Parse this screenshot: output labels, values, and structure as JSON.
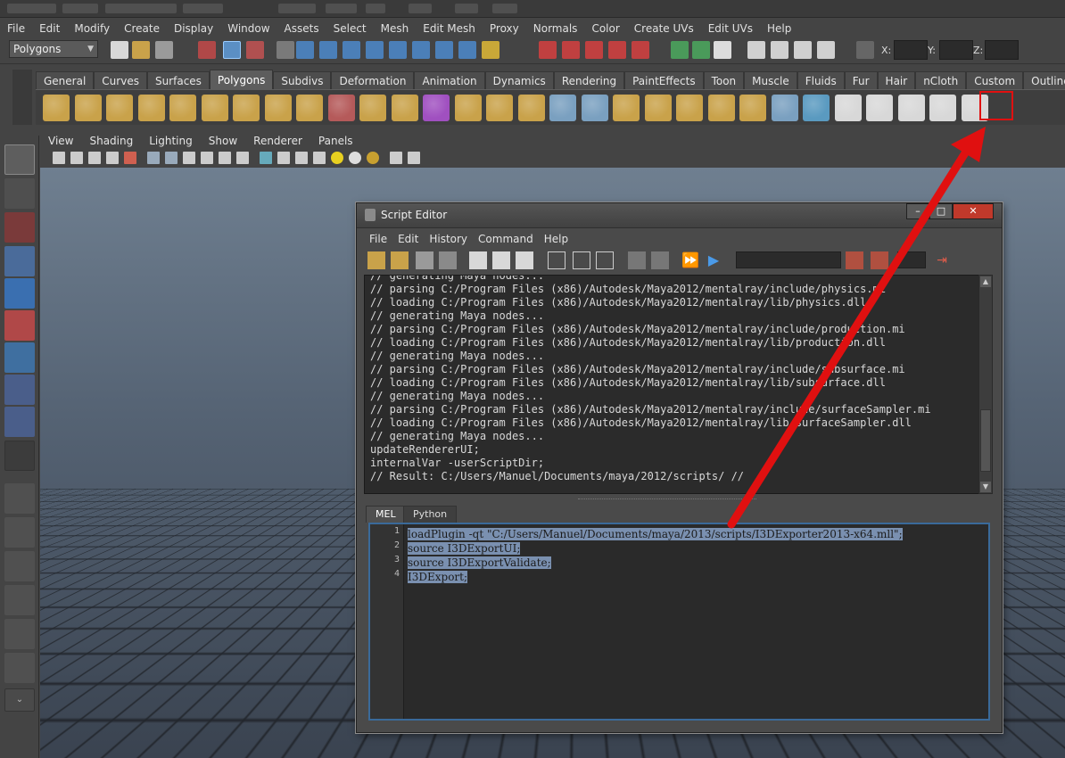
{
  "menubar": {
    "items": [
      "File",
      "Edit",
      "Modify",
      "Create",
      "Display",
      "Window",
      "Assets",
      "Select",
      "Mesh",
      "Edit Mesh",
      "Proxy",
      "Normals",
      "Color",
      "Create UVs",
      "Edit UVs",
      "Help"
    ]
  },
  "status_line": {
    "mode": "Polygons",
    "x_label": "X:",
    "y_label": "Y:",
    "z_label": "Z:"
  },
  "shelf": {
    "tabs": [
      "General",
      "Curves",
      "Surfaces",
      "Polygons",
      "Subdivs",
      "Deformation",
      "Animation",
      "Dynamics",
      "Rendering",
      "PaintEffects",
      "Toon",
      "Muscle",
      "Fluids",
      "Fur",
      "Hair",
      "nCloth",
      "Custom",
      "OutlinerPlus"
    ],
    "active_tab": "Polygons"
  },
  "viewport_menu": {
    "items": [
      "View",
      "Shading",
      "Lighting",
      "Show",
      "Renderer",
      "Panels"
    ]
  },
  "script_editor": {
    "title": "Script Editor",
    "menu": [
      "File",
      "Edit",
      "History",
      "Command",
      "Help"
    ],
    "history_lines": [
      "// generating Maya nodes...",
      "// parsing C:/Program Files (x86)/Autodesk/Maya2012/mentalray/include/physics.mi",
      "// loading C:/Program Files (x86)/Autodesk/Maya2012/mentalray/lib/physics.dll",
      "// generating Maya nodes...",
      "// parsing C:/Program Files (x86)/Autodesk/Maya2012/mentalray/include/production.mi",
      "// loading C:/Program Files (x86)/Autodesk/Maya2012/mentalray/lib/production.dll",
      "// generating Maya nodes...",
      "// parsing C:/Program Files (x86)/Autodesk/Maya2012/mentalray/include/subsurface.mi",
      "// loading C:/Program Files (x86)/Autodesk/Maya2012/mentalray/lib/subsurface.dll",
      "// generating Maya nodes...",
      "// parsing C:/Program Files (x86)/Autodesk/Maya2012/mentalray/include/surfaceSampler.mi",
      "// loading C:/Program Files (x86)/Autodesk/Maya2012/mentalray/lib/surfaceSampler.dll",
      "// generating Maya nodes...",
      "updateRendererUI;",
      "internalVar -userScriptDir;",
      "// Result: C:/Users/Manuel/Documents/maya/2012/scripts/ //"
    ],
    "tabs": [
      "MEL",
      "Python"
    ],
    "active_tab": "MEL",
    "line_numbers": [
      "1",
      "2",
      "3",
      "4"
    ],
    "code_lines": [
      "loadPlugin -qt \"C:/Users/Manuel/Documents/maya/2013/scripts/I3DExporter2013-x64.mll\";",
      "source I3DExportUI;",
      "source I3DExportValidate;",
      "I3DExport;"
    ]
  },
  "colors": {
    "annotation": "#e01010",
    "selection": "#7a90b0"
  }
}
